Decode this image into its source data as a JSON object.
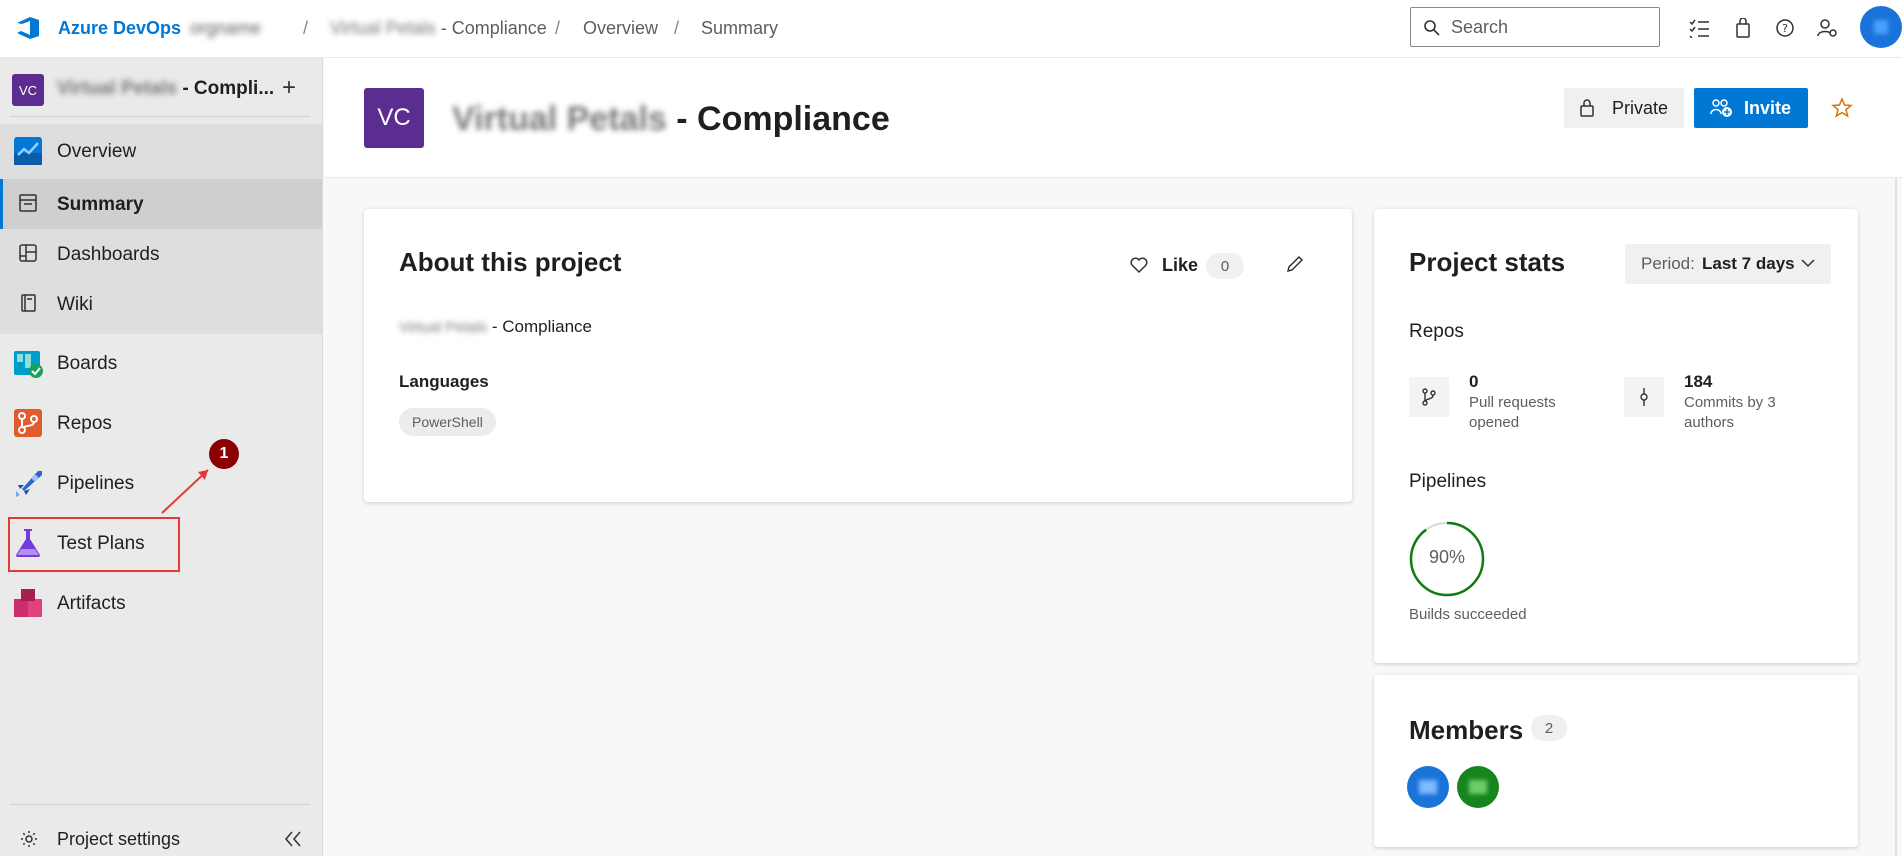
{
  "topbar": {
    "brand": "Azure DevOps",
    "org": "orgname",
    "breadcrumbs": [
      {
        "blurred": "Virtual Petals",
        "text": "- Compliance"
      },
      {
        "text": "Overview"
      },
      {
        "text": "Summary"
      }
    ],
    "separator": "/",
    "search_placeholder": "Search",
    "icons": [
      "work-items-icon",
      "marketplace-bag-icon",
      "help-icon",
      "user-settings-icon",
      "user-avatar"
    ]
  },
  "sidebar": {
    "project_initials": "VC",
    "project_blurred": "Virtual Petals",
    "project_suffix": "- Compli...",
    "add_label": "+",
    "items": [
      {
        "label": "Overview",
        "icon": "overview-icon"
      },
      {
        "label": "Summary",
        "icon": "summary-icon",
        "selected": true
      },
      {
        "label": "Dashboards",
        "icon": "dashboards-icon"
      },
      {
        "label": "Wiki",
        "icon": "wiki-icon"
      },
      {
        "label": "Boards",
        "icon": "boards-icon"
      },
      {
        "label": "Repos",
        "icon": "repos-icon"
      },
      {
        "label": "Pipelines",
        "icon": "pipelines-icon"
      },
      {
        "label": "Test Plans",
        "icon": "test-plans-icon"
      },
      {
        "label": "Artifacts",
        "icon": "artifacts-icon"
      }
    ],
    "settings_label": "Project settings",
    "callout_number": "1"
  },
  "header": {
    "initials": "VC",
    "title_blurred": "Virtual Petals",
    "title_suffix": "- Compliance",
    "private_label": "Private",
    "invite_label": "Invite"
  },
  "about": {
    "title": "About this project",
    "like_label": "Like",
    "like_count": "0",
    "description_blurred": "Virtual Petals",
    "description_suffix": "- Compliance",
    "languages_label": "Languages",
    "languages": [
      "PowerShell"
    ]
  },
  "stats": {
    "title": "Project stats",
    "period_label": "Period:",
    "period_value": "Last 7 days",
    "repos_label": "Repos",
    "pull_requests": {
      "value": "0",
      "caption": "Pull requests opened"
    },
    "commits": {
      "value": "184",
      "caption": "Commits by 3 authors"
    },
    "pipelines_label": "Pipelines",
    "builds_succeeded_percent": 90,
    "builds_label": "90%",
    "builds_caption": "Builds succeeded"
  },
  "members": {
    "title": "Members",
    "count": "2"
  },
  "colors": {
    "accent": "#0078d4",
    "project_tile": "#5c2d91",
    "success": "#107c10",
    "highlight": "#e53935",
    "callout": "#8b0000"
  }
}
